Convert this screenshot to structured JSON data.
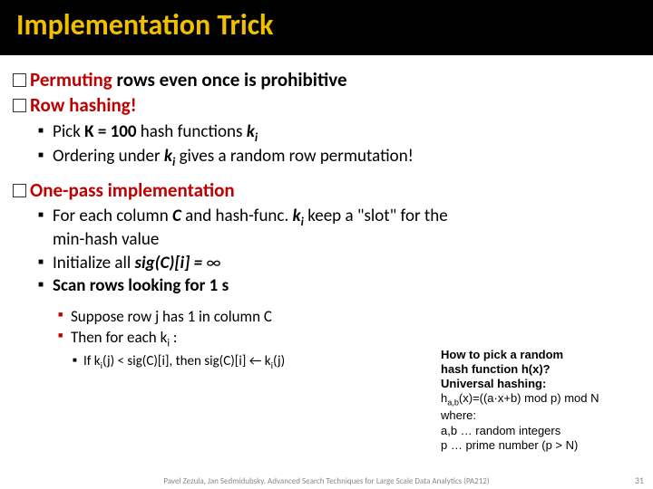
{
  "title": "Implementation Trick",
  "bullets": {
    "b1_lead": "Permuting",
    "b1_rest": " rows even once is prohibitive",
    "b2_lead": "Row hashing!",
    "b1s1_a": "Pick ",
    "b1s1_b": "K = 100",
    "b1s1_c": " hash functions ",
    "b1s1_d": "k",
    "b1s1_e": "i",
    "b1s2_a": "Ordering under ",
    "b1s2_b": "k",
    "b1s2_c": "i",
    "b1s2_d": " gives a random row permutation!",
    "b3_lead": "One-pass implementation",
    "b3s1_a": "For each column ",
    "b3s1_b": "C",
    "b3s1_c": " and hash-func. ",
    "b3s1_d": "k",
    "b3s1_e": "i",
    "b3s1_f": " keep a \"slot\" for the min-hash value",
    "b3s2_a": "Initialize all ",
    "b3s2_b": "sig(C)[i] = ",
    "b3s2_c": "∞",
    "b3s3_a": "Scan rows looking for 1 s",
    "b3s3s1_a": "Suppose row ",
    "b3s3s1_b": "j",
    "b3s3s1_c": " has 1 in column ",
    "b3s3s1_d": "C",
    "b3s3s2_a": "Then for each ",
    "b3s3s2_b": "k",
    "b3s3s2_c": "i",
    "b3s3s2_d": " :",
    "b3s3s2s1_a": "If ",
    "b3s3s2s1_b": "k",
    "b3s3s2s1_c": "i",
    "b3s3s2s1_d": "(j) < sig(C)[i]",
    "b3s3s2s1_e": ", then ",
    "b3s3s2s1_f": "sig(C)[i] ",
    "b3s3s2s1_g": "←",
    "b3s3s2s1_h": " k",
    "b3s3s2s1_i": "i",
    "b3s3s2s1_j": "(j)"
  },
  "side": {
    "l1": "How to pick a random",
    "l2": "hash function h(x)?",
    "l3": "Universal hashing:",
    "l4a": "h",
    "l4b": "a,b",
    "l4c": "(x)=((a·x+b) mod p) mod N",
    "l5": "where:",
    "l6": "a,b … random integers",
    "l7": "p … prime number (p > N)"
  },
  "footer": "Pavel Zezula, Jan Sedmidubsky. Advanced Search Techniques for Large Scale Data Analytics (PA212)",
  "page": "31"
}
